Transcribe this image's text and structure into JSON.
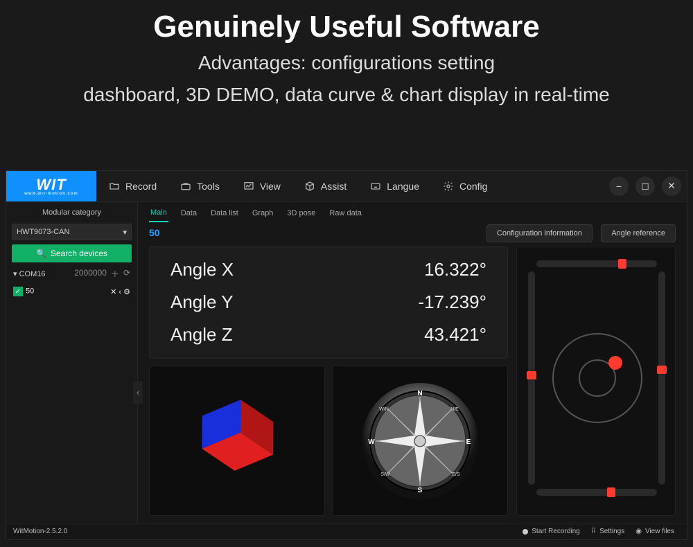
{
  "hero": {
    "title": "Genuinely Useful Software",
    "sub1": "Advantages: configurations setting",
    "sub2": "dashboard, 3D DEMO, data curve & chart display in real-time"
  },
  "logo": {
    "text": "WIT",
    "tag": "www.wit-motion.com"
  },
  "toolbar": {
    "record": "Record",
    "tools": "Tools",
    "view": "View",
    "assist": "Assist",
    "langue": "Langue",
    "config": "Config"
  },
  "sidebar": {
    "title": "Modular category",
    "module": "HWT9073-CAN",
    "search": "Search devices",
    "port": "COM16",
    "baud": "2000000",
    "device": "50"
  },
  "tabs": {
    "main": "Main",
    "data": "Data",
    "datalist": "Data list",
    "graph": "Graph",
    "pose": "3D pose",
    "raw": "Raw data"
  },
  "badge": "50",
  "buttons": {
    "configinfo": "Configuration information",
    "angleref": "Angle reference"
  },
  "angles": {
    "xlabel": "Angle X",
    "xval": "16.322°",
    "ylabel": "Angle Y",
    "yval": "-17.239°",
    "zlabel": "Angle Z",
    "zval": "43.421°"
  },
  "status": {
    "version": "WitMotion-2.5.2.0",
    "start": "Start Recording",
    "settings": "Settings",
    "viewfiles": "View files"
  },
  "colors": {
    "accent_blue": "#108fff",
    "accent_green": "#12b066",
    "accent_teal": "#18d0b4",
    "cube_red": "#e02020",
    "cube_blue": "#1a2fdc",
    "dot_red": "#ff3b30"
  }
}
